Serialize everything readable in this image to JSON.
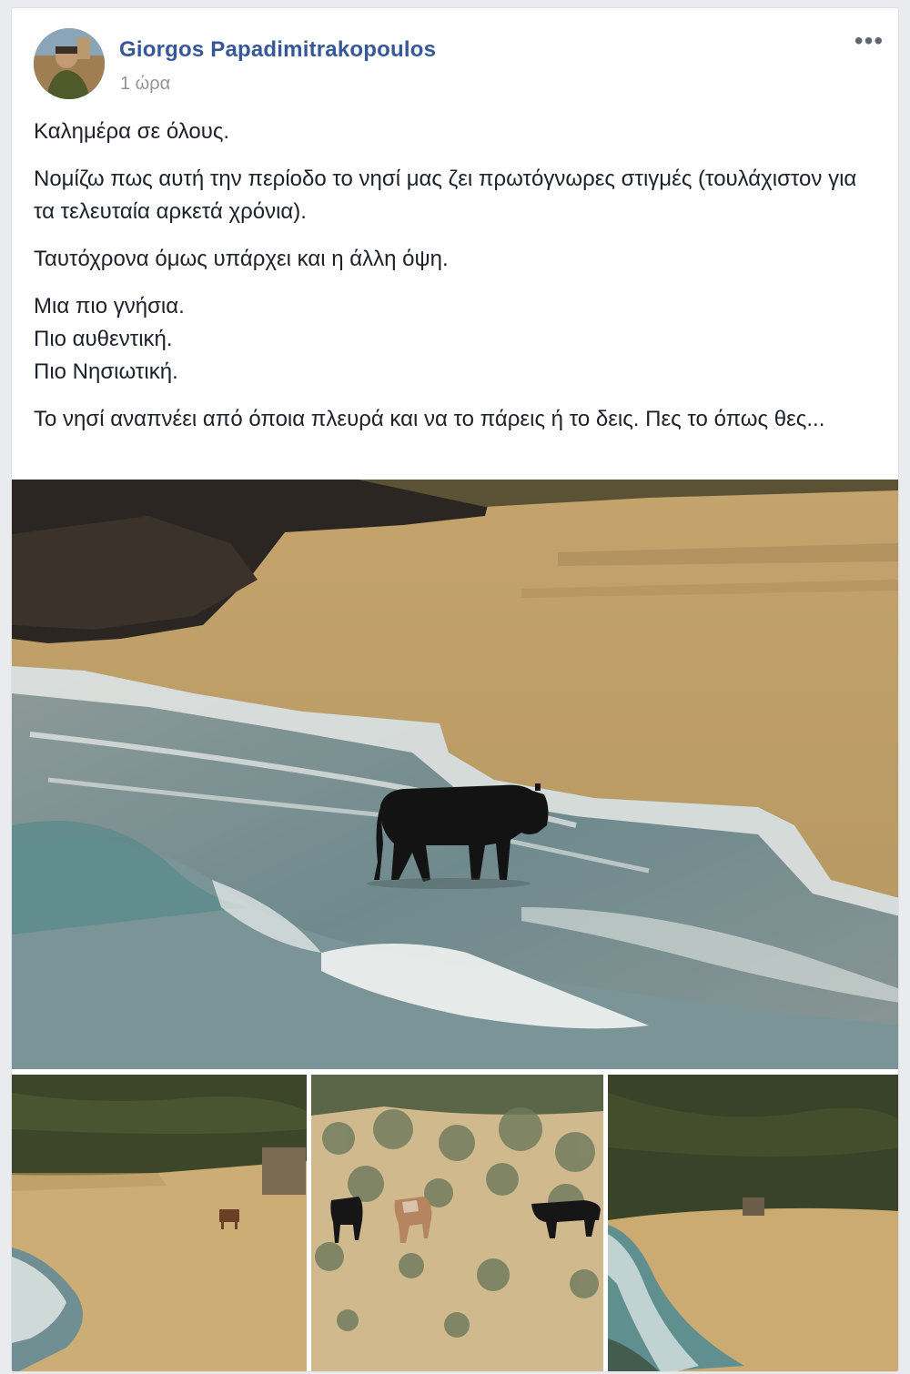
{
  "post": {
    "author": "Giorgos Papadimitrakopoulos",
    "timestamp": "1 ώρα",
    "more_menu": "•••",
    "paragraphs": [
      "Καλημέρα σε όλους.",
      "Νομίζω πως αυτή την περίοδο το νησί μας ζει πρωτόγνωρες στιγμές (τουλάχιστον για τα τελευταία αρκετά χρόνια).",
      "Ταυτόχρονα όμως υπάρχει και η άλλη όψη.",
      "Μια πιο γνήσια.\nΠιο αυθεντική.\nΠιο Νησιωτική.",
      "Το νησί αναπνέει από όποια πλευρά και να το πάρεις ή το δεις. Πες το όπως θες..."
    ]
  },
  "colors": {
    "author_link": "#365899",
    "body_text": "#1d2129",
    "meta_text": "#90949c",
    "sand": "#c9aa73",
    "sea": "#6f8a8e",
    "scrub": "#3f4a2a"
  }
}
